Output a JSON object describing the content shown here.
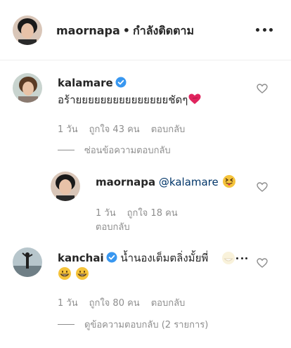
{
  "header": {
    "username": "maornapa",
    "separator": "•",
    "follow_status": "กำลังติดตาม"
  },
  "comments": [
    {
      "username": "kalamare",
      "verified": true,
      "text": "อร้ายยยยยยยยยยยยยยยชัดๆ",
      "time": "1 วัน",
      "likes": "ถูกใจ 43 คน",
      "reply_label": "ตอบกลับ",
      "replies_toggle": "ซ่อนข้อความตอบกลับ",
      "reply": {
        "username": "maornapa",
        "mention": "@kalamare",
        "time": "1 วัน",
        "likes": "ถูกใจ 18 คน",
        "reply_label": "ตอบกลับ"
      }
    },
    {
      "username": "kanchai",
      "verified": true,
      "text": "น้ำนองเต็มตลิ่งมั้ยพี่",
      "time": "1 วัน",
      "likes": "ถูกใจ 80 คน",
      "reply_label": "ตอบกลับ",
      "replies_toggle": "ดูข้อความตอบกลับ (2 รายการ)"
    }
  ],
  "colors": {
    "text": "#262626",
    "secondary": "#8e8e8e",
    "mention": "#003569",
    "verified": "#3897f0"
  },
  "icons": [
    "more-icon",
    "verified-badge-icon",
    "heart-icon",
    "heart-emoji-icon",
    "tongue-emoji-icon",
    "grin-emoji-icon"
  ]
}
